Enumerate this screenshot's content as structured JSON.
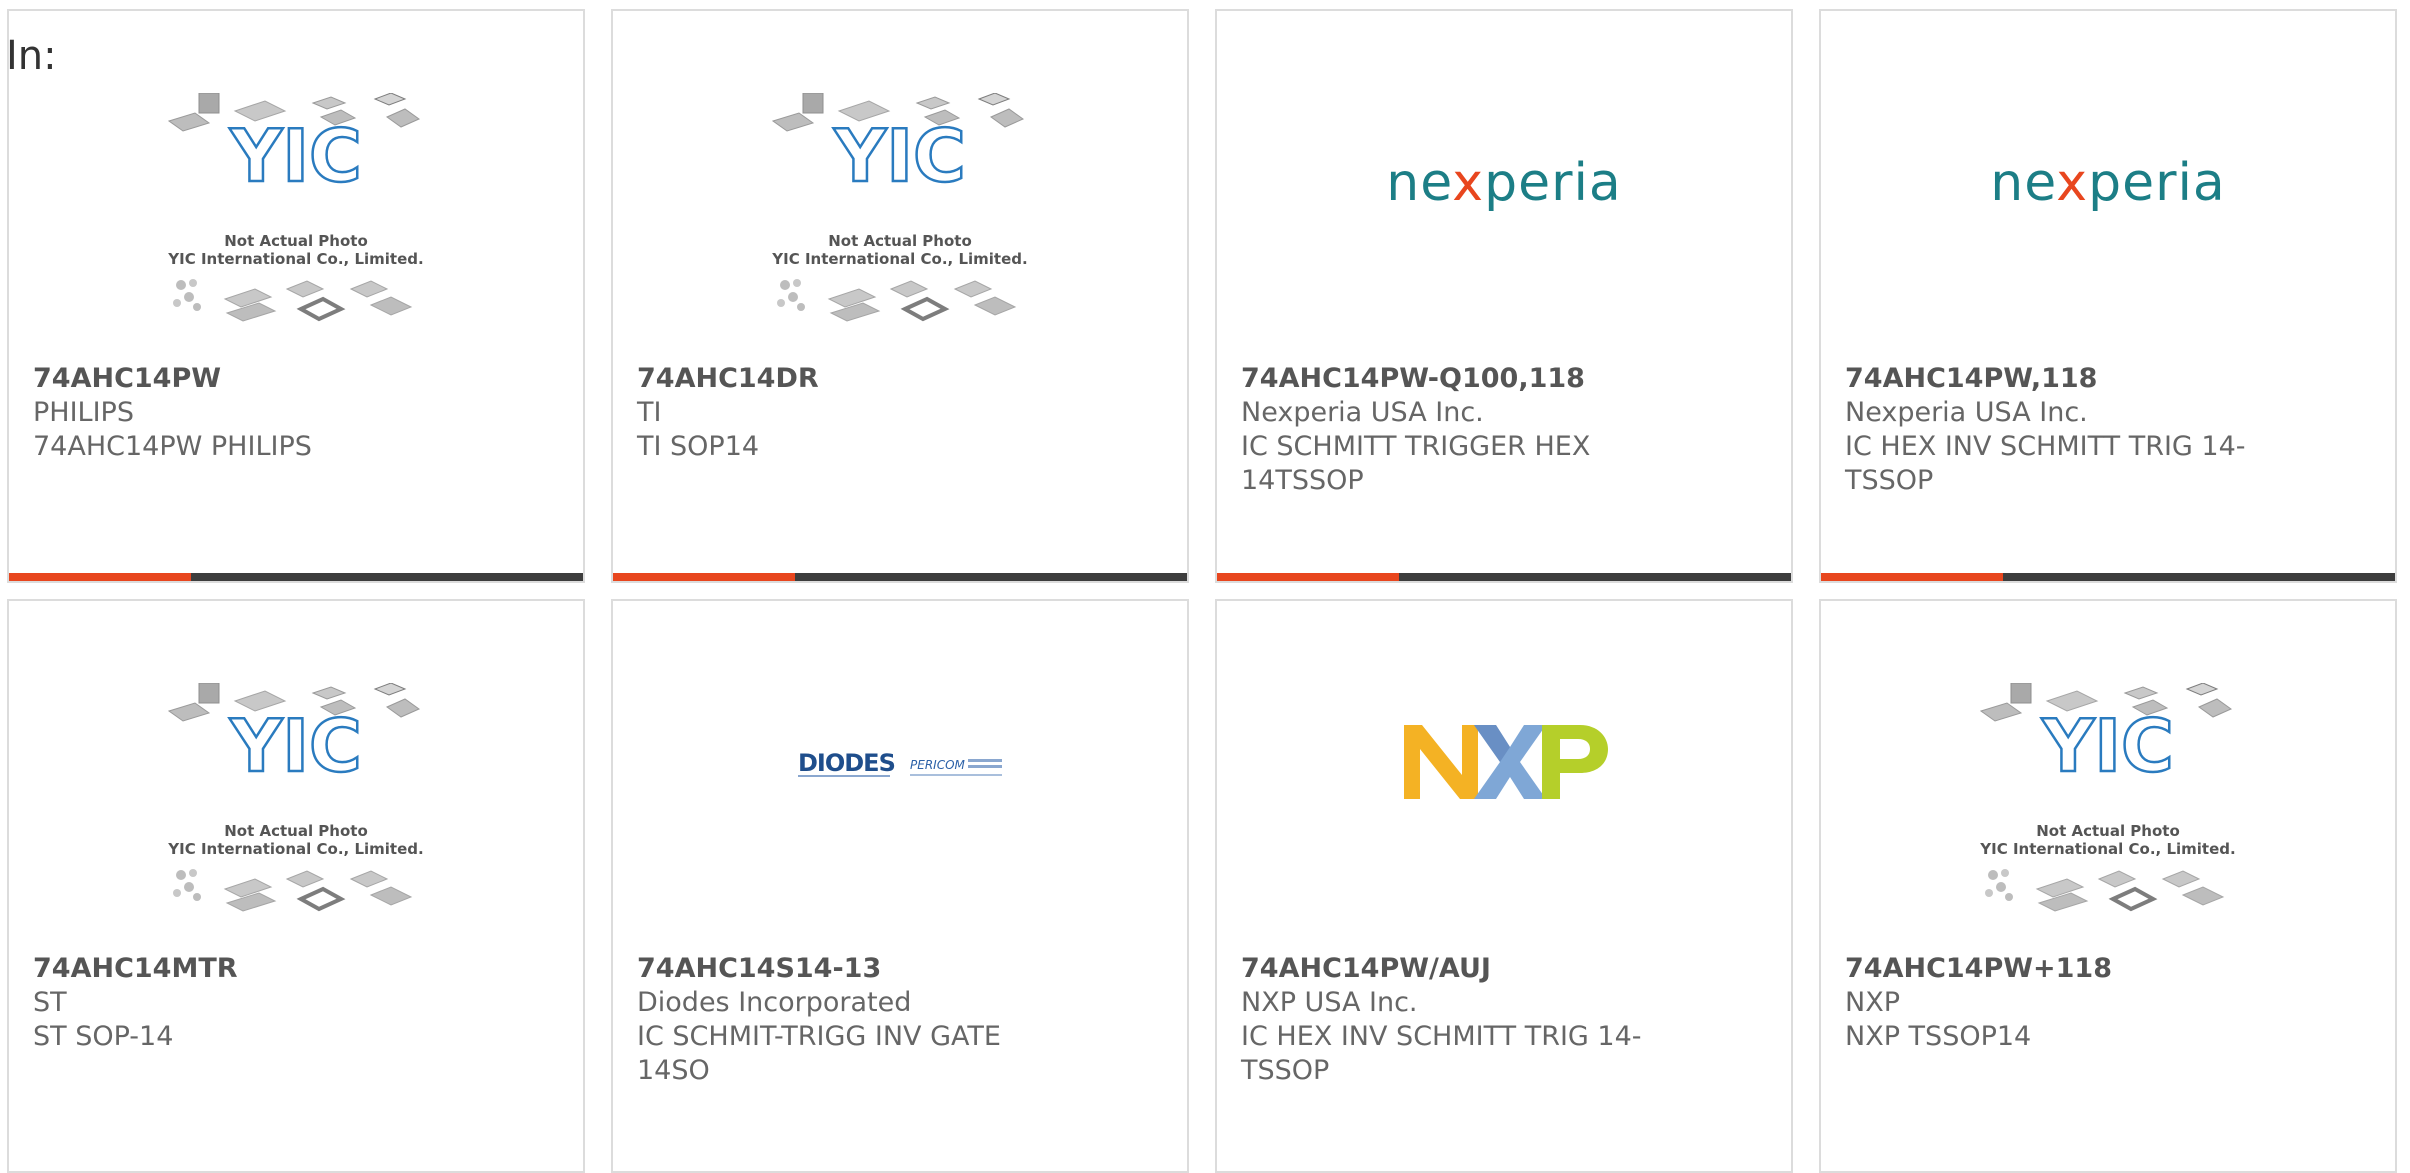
{
  "page": {
    "label": "In:"
  },
  "colors": {
    "accent": "#e8461e",
    "bar": "#3d3d3d",
    "nexperia": "#1c7e86"
  },
  "yic_caption": {
    "line1": "Not Actual Photo",
    "line2": "YIC International Co., Limited."
  },
  "cards": [
    {
      "image": "yic-placeholder",
      "part_number": "74AHC14PW",
      "manufacturer": "PHILIPS",
      "description": "74AHC14PW PHILIPS"
    },
    {
      "image": "yic-placeholder",
      "part_number": "74AHC14DR",
      "manufacturer": "TI",
      "description": "TI SOP14"
    },
    {
      "image": "nexperia-logo",
      "logo_text": "nexperia",
      "part_number": "74AHC14PW-Q100,118",
      "manufacturer": "Nexperia USA Inc.",
      "description": "IC SCHMITT TRIGGER HEX 14TSSOP"
    },
    {
      "image": "nexperia-logo",
      "logo_text": "nexperia",
      "part_number": "74AHC14PW,118",
      "manufacturer": "Nexperia USA Inc.",
      "description": "IC HEX INV SCHMITT TRIG 14-TSSOP"
    },
    {
      "image": "yic-placeholder",
      "part_number": "74AHC14MTR",
      "manufacturer": "ST",
      "description": "ST SOP-14"
    },
    {
      "image": "diodes-pericom-logo",
      "logo_text": "DIODES",
      "logo_text2": "PERICOM",
      "part_number": "74AHC14S14-13",
      "manufacturer": "Diodes Incorporated",
      "description": "IC SCHMIT-TRIGG INV GATE 14SO"
    },
    {
      "image": "nxp-logo",
      "part_number": "74AHC14PW/AUJ",
      "manufacturer": "NXP USA Inc.",
      "description": "IC HEX INV SCHMITT TRIG 14-TSSOP"
    },
    {
      "image": "yic-placeholder",
      "part_number": "74AHC14PW+118",
      "manufacturer": "NXP",
      "description": "NXP TSSOP14"
    }
  ]
}
